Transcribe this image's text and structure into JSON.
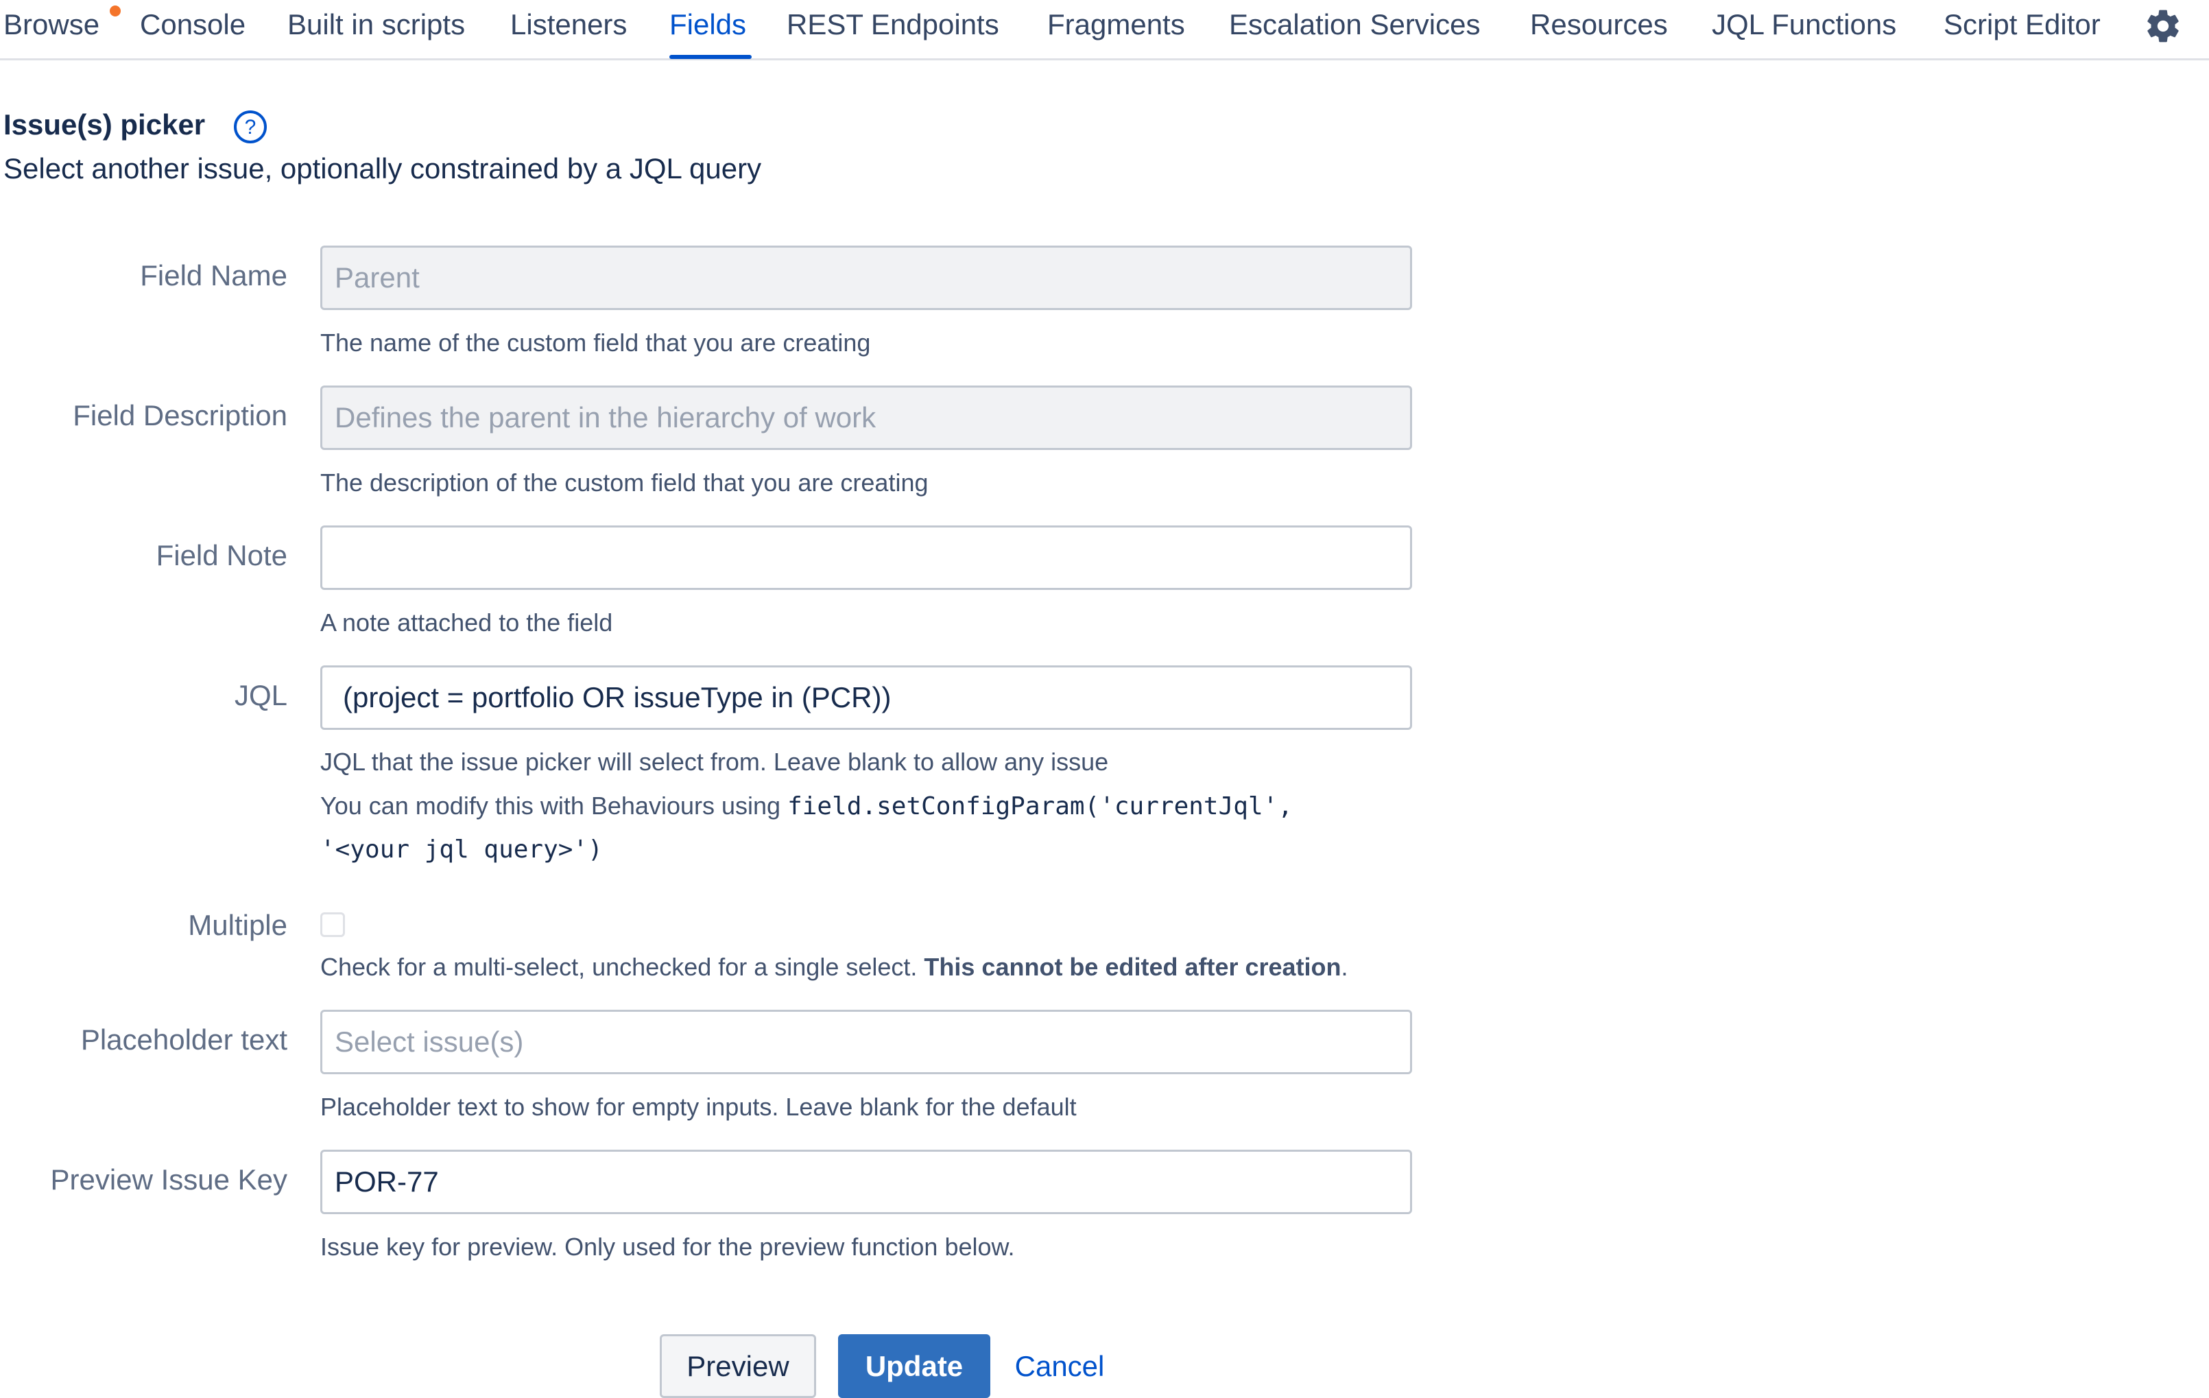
{
  "nav": {
    "items": [
      {
        "label": "Browse"
      },
      {
        "label": "Console"
      },
      {
        "label": "Built in scripts"
      },
      {
        "label": "Listeners"
      },
      {
        "label": "Fields"
      },
      {
        "label": "REST Endpoints"
      },
      {
        "label": "Fragments"
      },
      {
        "label": "Escalation Services"
      },
      {
        "label": "Resources"
      },
      {
        "label": "JQL Functions"
      },
      {
        "label": "Script Editor"
      }
    ],
    "active": "Fields",
    "settings_icon": "gear-icon",
    "notification_color": "#f4742a"
  },
  "section": {
    "title": "Issue(s) picker",
    "help_icon": "question-circle-icon",
    "description": "Select another issue, optionally constrained by a JQL query"
  },
  "form": {
    "field_name": {
      "label": "Field Name",
      "value": "Parent",
      "help": "The name of the custom field that you are creating"
    },
    "field_description": {
      "label": "Field Description",
      "value": "Defines the parent in the hierarchy of work",
      "help": "The description of the custom field that you are creating"
    },
    "field_note": {
      "label": "Field Note",
      "value": "",
      "help": "A note attached to the field"
    },
    "jql": {
      "label": "JQL",
      "value": "(project = portfolio OR issueType in (PCR))",
      "help": "JQL that the issue picker will select from. Leave blank to allow any issue",
      "help2_prefix": "You can modify this with Behaviours using",
      "help2_code1": "field.setConfigParam('currentJql',",
      "help2_code2": "'<your jql query>')"
    },
    "multiple": {
      "label": "Multiple",
      "checked": false,
      "help_prefix": "Check for a multi-select, unchecked for a single select.",
      "help_bold": "This cannot be edited after creation",
      "help_suffix": "."
    },
    "placeholder_text": {
      "label": "Placeholder text",
      "value": "",
      "placeholder": "Select issue(s)",
      "help": "Placeholder text to show for empty inputs. Leave blank for the default"
    },
    "preview_issue_key": {
      "label": "Preview Issue Key",
      "value": "POR-77",
      "help": "Issue key for preview. Only used for the preview function below."
    }
  },
  "buttons": {
    "preview": "Preview",
    "update": "Update",
    "cancel": "Cancel"
  },
  "colors": {
    "accent": "#0052cc",
    "primary_button": "#2f6fbd",
    "notification_dot": "#f4742a"
  }
}
